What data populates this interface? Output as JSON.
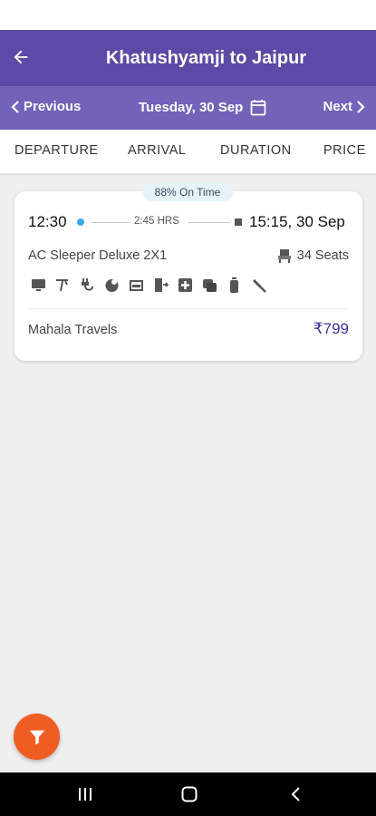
{
  "header": {
    "title": "Khatushyamji to Jaipur"
  },
  "date_bar": {
    "previous_label": "Previous",
    "date": "Tuesday, 30 Sep",
    "next_label": "Next"
  },
  "sort_tabs": [
    "DEPARTURE",
    "ARRIVAL",
    "DURATION",
    "PRICE"
  ],
  "result": {
    "on_time": "88% On Time",
    "departure_time": "12:30",
    "duration": "2:45 HRS",
    "arrival_time": "15:15, 30 Sep",
    "bus_type": "AC Sleeper Deluxe 2X1",
    "seats": "34 Seats",
    "operator": "Mahala Travels",
    "price": "₹799",
    "amenities": [
      "tv-icon",
      "sprinkler-icon",
      "charging-plug-icon",
      "snack-icon",
      "sleeper-icon",
      "exit-icon",
      "first-aid-icon",
      "blanket-icon",
      "water-bottle-icon",
      "emergency-hammer-icon"
    ]
  },
  "colors": {
    "app_bar": "#5c4aa6",
    "date_bar": "#7262b8",
    "price": "#3b33a0",
    "fab": "#f05d23",
    "departure_dot": "#3aa8ec"
  },
  "icons": {
    "back": "arrow-left-icon",
    "calendar": "calendar-icon",
    "filter": "filter-icon",
    "seat": "seat-icon"
  }
}
